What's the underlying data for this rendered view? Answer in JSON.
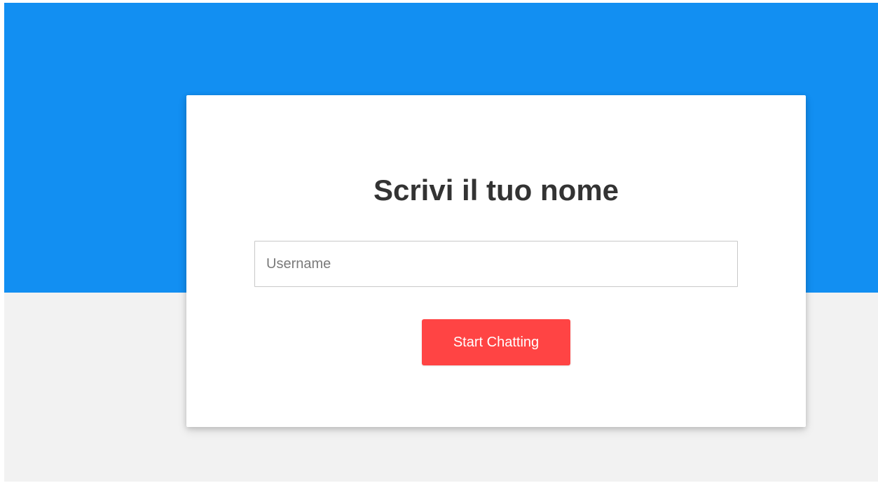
{
  "colors": {
    "hero_background": "#128ff2",
    "page_background": "#f2f2f2",
    "card_background": "#ffffff",
    "button_background": "#ff4444",
    "title_color": "#333333"
  },
  "card": {
    "title": "Scrivi il tuo nome",
    "username_field": {
      "value": "",
      "placeholder": "Username"
    },
    "start_button_label": "Start Chatting"
  }
}
